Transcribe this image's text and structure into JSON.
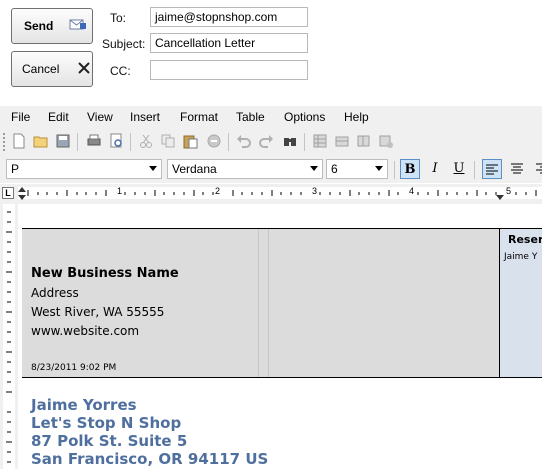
{
  "email": {
    "send_label": "Send",
    "cancel_label": "Cancel",
    "to_label": "To:",
    "to_value": "jaime@stopnshop.com",
    "subject_label": "Subject:",
    "subject_value": "Cancellation Letter",
    "cc_label": "CC:",
    "cc_value": ""
  },
  "menu": [
    "File",
    "Edit",
    "View",
    "Insert",
    "Format",
    "Table",
    "Options",
    "Help"
  ],
  "format": {
    "style": "P",
    "font": "Verdana",
    "size": "6",
    "bold": "B",
    "italic": "I",
    "underline": "U"
  },
  "ruler": {
    "corner": "L",
    "marks": [
      "1",
      "2",
      "3",
      "4",
      "5"
    ]
  },
  "document": {
    "business_name": "New Business Name",
    "address": "Address",
    "city_line": "West River, WA 55555",
    "website": "www.website.com",
    "datetime": "8/23/2011 9:02 PM",
    "reservation_header": "Reser",
    "reservation_name": "Jaime Y",
    "recipient": {
      "name": "Jaime Yorres",
      "company": "Let's Stop N Shop",
      "street": "87 Polk St. Suite 5",
      "city": "San Francisco, OR 94117 US"
    }
  },
  "colors": {
    "header_cell": "#dcdcdc",
    "reservation_cell": "#d9e1ec",
    "recipient_text": "#4f6f9e",
    "active_button": "#cfe3f7"
  }
}
